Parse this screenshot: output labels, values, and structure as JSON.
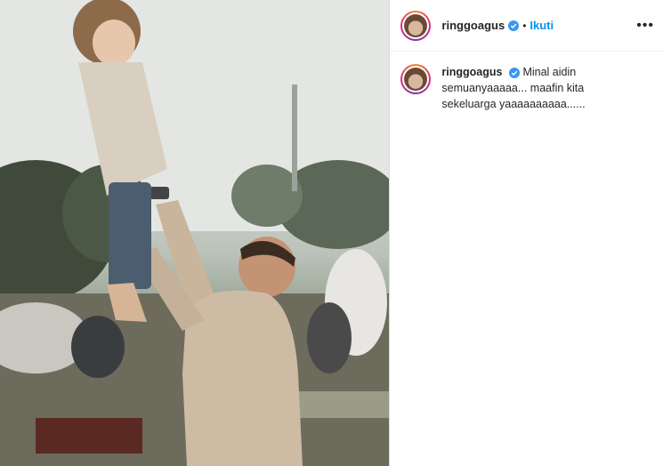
{
  "post": {
    "username": "ringgoagus",
    "follow_label": "Ikuti",
    "separator": "•",
    "more_label": "•••",
    "caption": "Minal aidin semuanyaaaaa... maafin kita sekeluarga yaaaaaaaaaa......"
  },
  "colors": {
    "follow": "#0095f6",
    "verified": "#3897f0",
    "text": "#262626"
  },
  "icons": [
    "verified-badge-icon",
    "more-options-icon",
    "avatar-image"
  ]
}
